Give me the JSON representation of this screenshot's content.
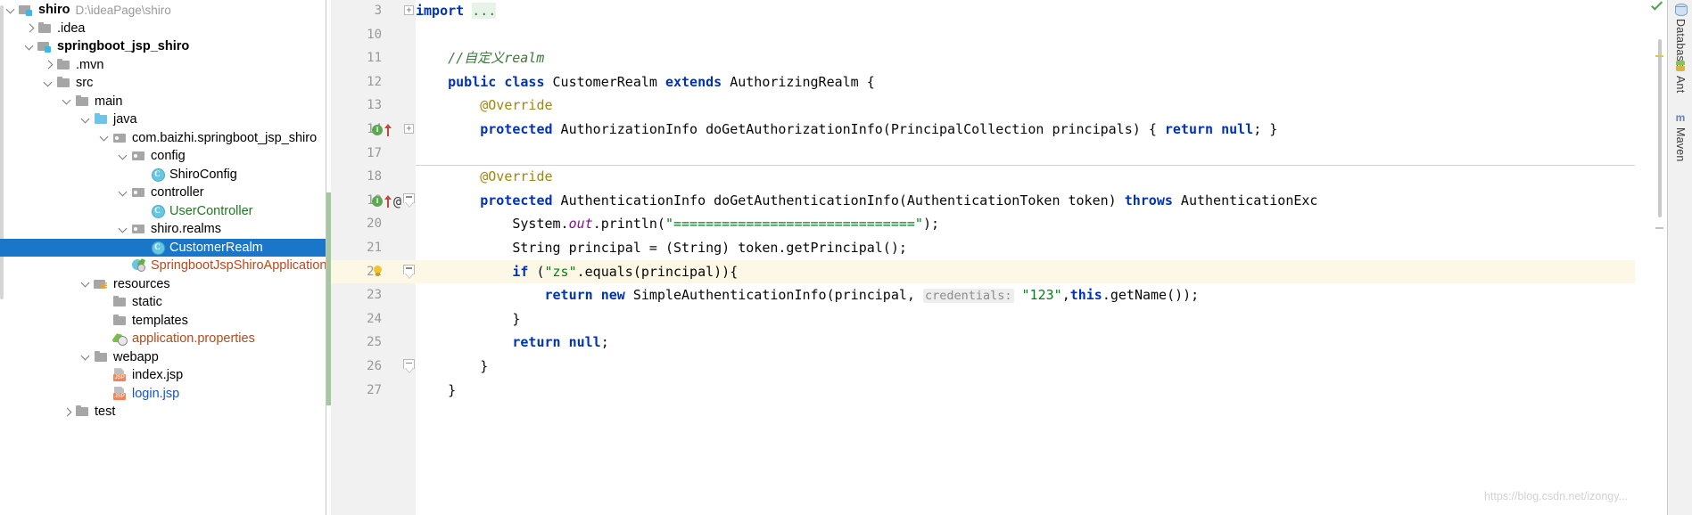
{
  "project_tree": {
    "name": "Project",
    "items": [
      {
        "depth": 0,
        "arrow": "down",
        "icon": "module",
        "label": "shiro",
        "style": "bold",
        "path": "D:\\ideaPage\\shiro"
      },
      {
        "depth": 1,
        "arrow": "right",
        "icon": "folder",
        "label": ".idea",
        "style": "",
        "path": ""
      },
      {
        "depth": 1,
        "arrow": "down",
        "icon": "module",
        "label": "springboot_jsp_shiro",
        "style": "bold",
        "path": ""
      },
      {
        "depth": 2,
        "arrow": "right",
        "icon": "folder",
        "label": ".mvn",
        "style": "",
        "path": ""
      },
      {
        "depth": 2,
        "arrow": "down",
        "icon": "folder",
        "label": "src",
        "style": "",
        "path": ""
      },
      {
        "depth": 3,
        "arrow": "down",
        "icon": "folder",
        "label": "main",
        "style": "",
        "path": ""
      },
      {
        "depth": 4,
        "arrow": "down",
        "icon": "folder-blue",
        "label": "java",
        "style": "",
        "path": ""
      },
      {
        "depth": 5,
        "arrow": "down",
        "icon": "package",
        "label": "com.baizhi.springboot_jsp_shiro",
        "style": "",
        "path": ""
      },
      {
        "depth": 6,
        "arrow": "down",
        "icon": "package",
        "label": "config",
        "style": "",
        "path": ""
      },
      {
        "depth": 7,
        "arrow": "none",
        "icon": "class",
        "label": "ShiroConfig",
        "style": "",
        "path": ""
      },
      {
        "depth": 6,
        "arrow": "down",
        "icon": "package",
        "label": "controller",
        "style": "",
        "path": ""
      },
      {
        "depth": 7,
        "arrow": "none",
        "icon": "class",
        "label": "UserController",
        "style": "green",
        "path": ""
      },
      {
        "depth": 6,
        "arrow": "down",
        "icon": "package",
        "label": "shiro.realms",
        "style": "",
        "path": ""
      },
      {
        "depth": 7,
        "arrow": "none",
        "icon": "class",
        "label": "CustomerRealm",
        "style": "selected",
        "path": ""
      },
      {
        "depth": 6,
        "arrow": "none",
        "icon": "spring-app",
        "label": "SpringbootJspShiroApplication",
        "style": "brown",
        "path": ""
      },
      {
        "depth": 4,
        "arrow": "down",
        "icon": "resources",
        "label": "resources",
        "style": "",
        "path": ""
      },
      {
        "depth": 5,
        "arrow": "none",
        "icon": "folder",
        "label": "static",
        "style": "",
        "path": ""
      },
      {
        "depth": 5,
        "arrow": "none",
        "icon": "folder",
        "label": "templates",
        "style": "",
        "path": ""
      },
      {
        "depth": 5,
        "arrow": "none",
        "icon": "properties",
        "label": "application.properties",
        "style": "brown",
        "path": ""
      },
      {
        "depth": 4,
        "arrow": "down",
        "icon": "folder",
        "label": "webapp",
        "style": "",
        "path": ""
      },
      {
        "depth": 5,
        "arrow": "none",
        "icon": "jsp",
        "label": "index.jsp",
        "style": "",
        "path": ""
      },
      {
        "depth": 5,
        "arrow": "none",
        "icon": "jsp",
        "label": "login.jsp",
        "style": "blue",
        "path": ""
      },
      {
        "depth": 3,
        "arrow": "right",
        "icon": "folder",
        "label": "test",
        "style": "",
        "path": ""
      }
    ],
    "jsp_badge": "JSP",
    "class_badge": "C"
  },
  "editor": {
    "selected_line": 22,
    "lines": [
      {
        "num": "3",
        "markers": [],
        "fold": "plus",
        "tokens": [
          {
            "t": "import ",
            "c": "kw"
          },
          {
            "t": "...",
            "c": "fold-dots"
          }
        ]
      },
      {
        "num": "10",
        "markers": [],
        "fold": "",
        "tokens": []
      },
      {
        "num": "11",
        "markers": [],
        "fold": "",
        "tokens": [
          {
            "t": "    //自定义realm",
            "c": "cmt"
          }
        ]
      },
      {
        "num": "12",
        "markers": [],
        "fold": "",
        "tokens": [
          {
            "t": "    ",
            "c": "plain"
          },
          {
            "t": "public class",
            "c": "kw"
          },
          {
            "t": " CustomerRealm ",
            "c": "plain"
          },
          {
            "t": "extends",
            "c": "kw"
          },
          {
            "t": " AuthorizingRealm {",
            "c": "plain"
          }
        ]
      },
      {
        "num": "13",
        "markers": [],
        "fold": "",
        "tokens": [
          {
            "t": "        @Override",
            "c": "anno"
          }
        ]
      },
      {
        "num": "14",
        "markers": [
          "impl",
          "arrow-up"
        ],
        "fold": "plus",
        "tokens": [
          {
            "t": "        ",
            "c": "plain"
          },
          {
            "t": "protected",
            "c": "kw"
          },
          {
            "t": " AuthorizationInfo doGetAuthorizationInfo(PrincipalCollection principals) ",
            "c": "plain"
          },
          {
            "t": "{ ",
            "c": "plain"
          },
          {
            "t": "return",
            "c": "kw"
          },
          {
            "t": " ",
            "c": "plain"
          },
          {
            "t": "null",
            "c": "kw"
          },
          {
            "t": "; }",
            "c": "plain"
          }
        ]
      },
      {
        "num": "17",
        "markers": [],
        "fold": "",
        "tokens": []
      },
      {
        "num": "18",
        "markers": [],
        "fold": "",
        "tokens": [
          {
            "t": "        @Override",
            "c": "anno"
          }
        ]
      },
      {
        "num": "19",
        "markers": [
          "impl",
          "arrow-up",
          "at"
        ],
        "fold": "collapse",
        "tokens": [
          {
            "t": "        ",
            "c": "plain"
          },
          {
            "t": "protected",
            "c": "kw"
          },
          {
            "t": " AuthenticationInfo doGetAuthenticationInfo(AuthenticationToken token) ",
            "c": "plain"
          },
          {
            "t": "throws",
            "c": "kw"
          },
          {
            "t": " AuthenticationExc",
            "c": "plain"
          }
        ]
      },
      {
        "num": "20",
        "markers": [],
        "fold": "",
        "tokens": [
          {
            "t": "            System.",
            "c": "plain"
          },
          {
            "t": "out",
            "c": "field"
          },
          {
            "t": ".println(",
            "c": "plain"
          },
          {
            "t": "\"==============================\"",
            "c": "str"
          },
          {
            "t": ");",
            "c": "plain"
          }
        ]
      },
      {
        "num": "21",
        "markers": [],
        "fold": "",
        "tokens": [
          {
            "t": "            String principal = (String) token.getPrincipal();",
            "c": "plain"
          }
        ]
      },
      {
        "num": "22",
        "markers": [
          "bulb"
        ],
        "fold": "collapse",
        "tokens": [
          {
            "t": "            ",
            "c": "plain"
          },
          {
            "t": "if",
            "c": "kw"
          },
          {
            "t": " (",
            "c": "plain"
          },
          {
            "t": "\"zs\"",
            "c": "str"
          },
          {
            "t": ".equals(principal)){",
            "c": "plain"
          }
        ]
      },
      {
        "num": "23",
        "markers": [],
        "fold": "",
        "tokens": [
          {
            "t": "                ",
            "c": "plain"
          },
          {
            "t": "return",
            "c": "kw"
          },
          {
            "t": " ",
            "c": "plain"
          },
          {
            "t": "new",
            "c": "kw"
          },
          {
            "t": " SimpleAuthenticationInfo(principal, ",
            "c": "plain"
          },
          {
            "t": "credentials:",
            "c": "hintbg"
          },
          {
            "t": " ",
            "c": "plain"
          },
          {
            "t": "\"123\"",
            "c": "str"
          },
          {
            "t": ",",
            "c": "plain"
          },
          {
            "t": "this",
            "c": "kw"
          },
          {
            "t": ".getName());",
            "c": "plain"
          }
        ]
      },
      {
        "num": "24",
        "markers": [],
        "fold": "",
        "tokens": [
          {
            "t": "            }",
            "c": "plain"
          }
        ]
      },
      {
        "num": "25",
        "markers": [],
        "fold": "",
        "tokens": [
          {
            "t": "            ",
            "c": "plain"
          },
          {
            "t": "return",
            "c": "kw"
          },
          {
            "t": " ",
            "c": "plain"
          },
          {
            "t": "null",
            "c": "kw"
          },
          {
            "t": ";",
            "c": "plain"
          }
        ]
      },
      {
        "num": "26",
        "markers": [],
        "fold": "collapse",
        "tokens": [
          {
            "t": "        }",
            "c": "plain"
          }
        ]
      },
      {
        "num": "27",
        "markers": [],
        "fold": "",
        "tokens": [
          {
            "t": "    }",
            "c": "plain"
          }
        ]
      }
    ]
  },
  "tool_windows": {
    "items": [
      {
        "label": "Database",
        "icon": "database-icon"
      },
      {
        "label": "Ant",
        "icon": "ant-icon"
      },
      {
        "label": "Maven",
        "icon": "maven-icon"
      }
    ]
  },
  "watermark": {
    "text": "https://blog.csdn.net/izongy..."
  },
  "colors": {
    "selection": "#1976c8",
    "highlight_line": "#fcf8e5",
    "keyword": "#0033b3",
    "string": "#067d17",
    "comment": "#3a7a3a",
    "annotation": "#9e880d",
    "changebar": "#a6c8a0"
  }
}
